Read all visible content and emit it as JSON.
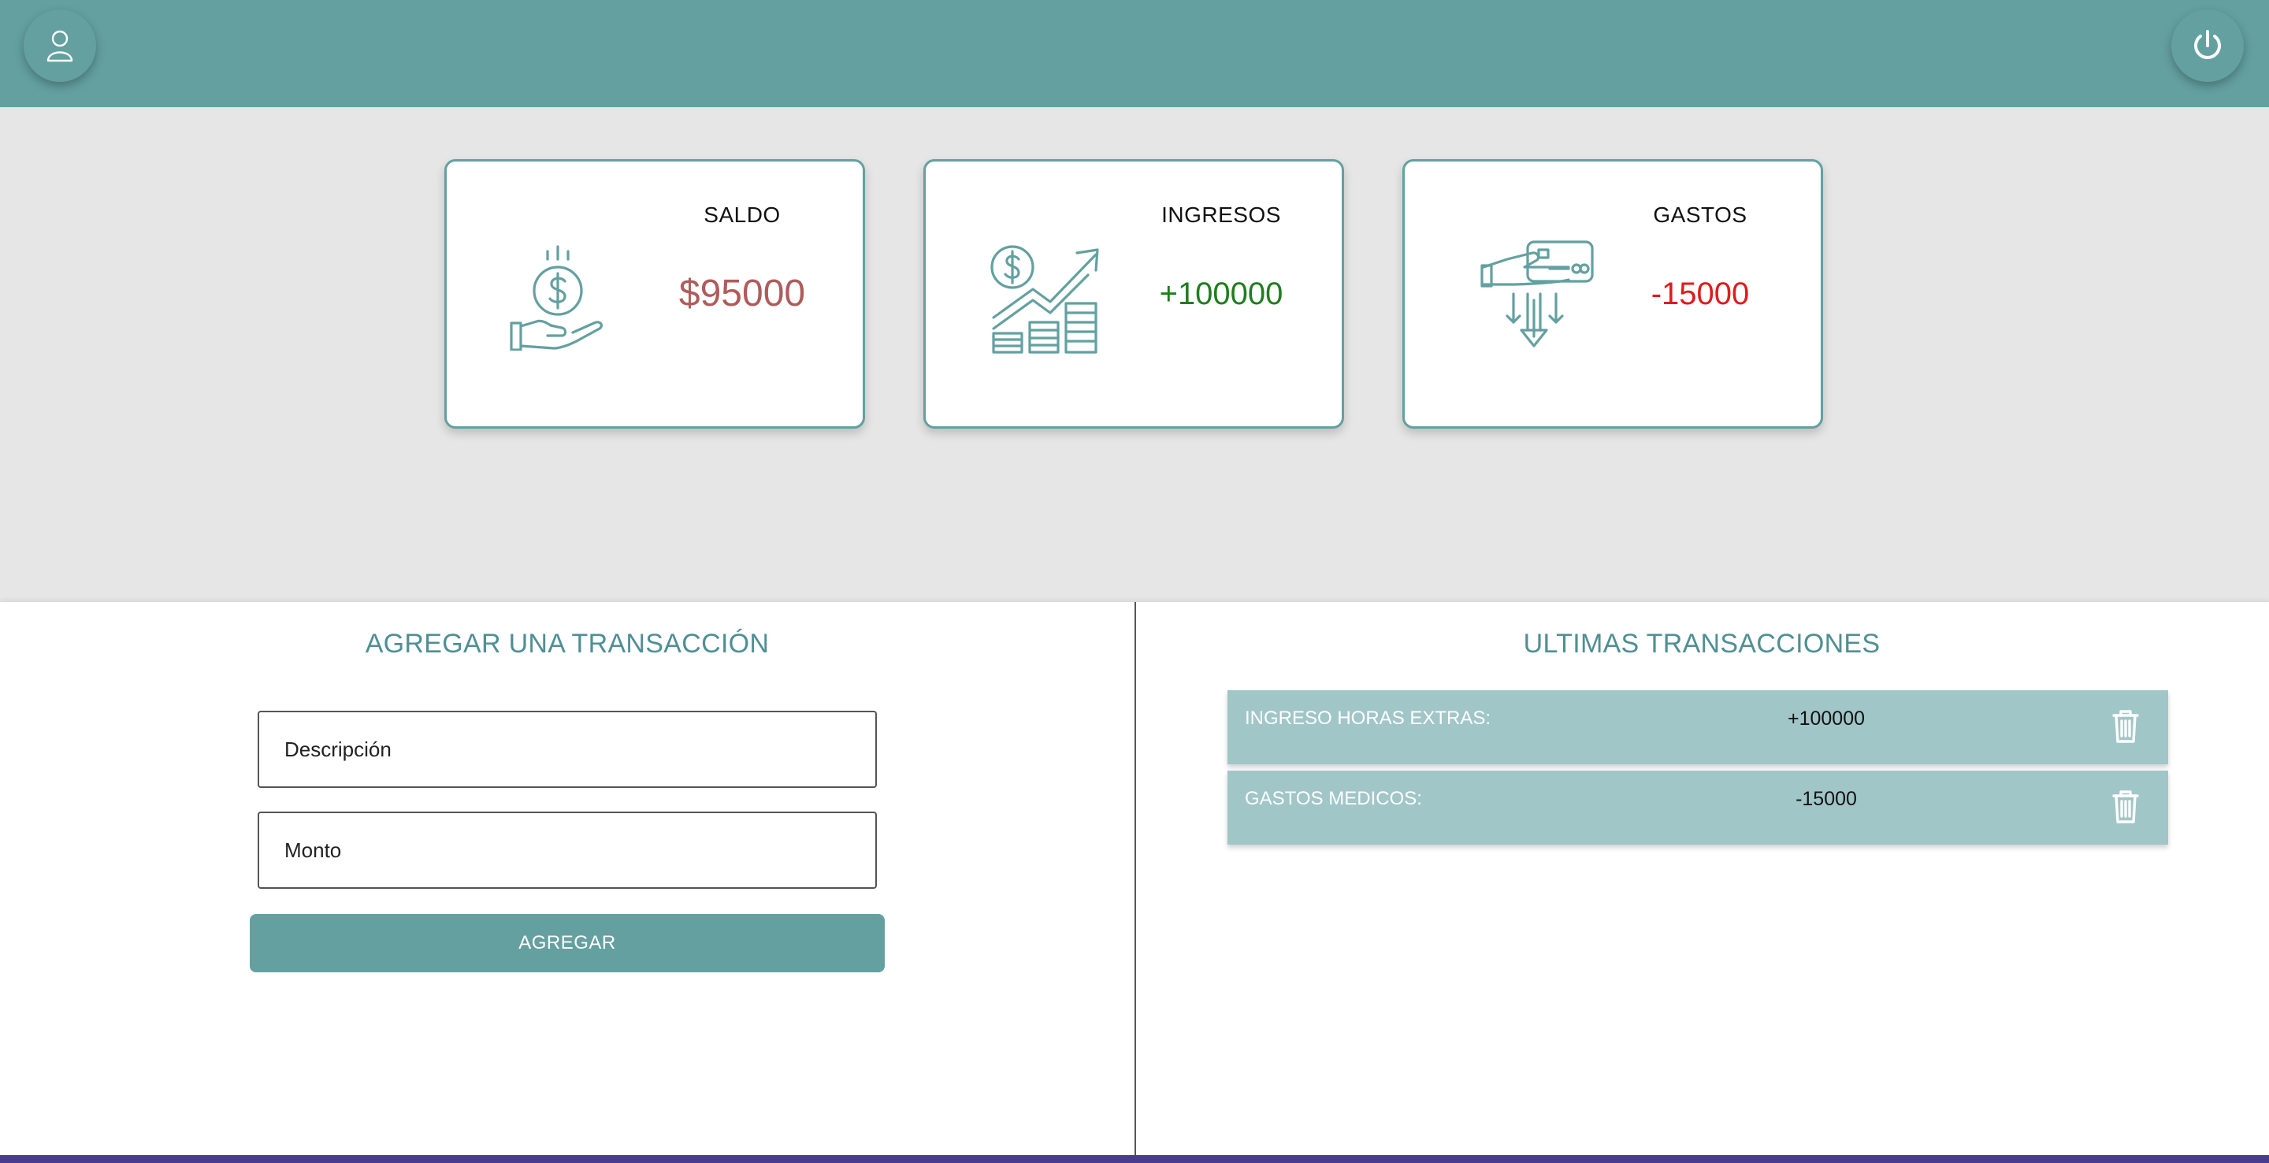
{
  "header": {
    "user_icon": "user-icon",
    "power_icon": "power-icon",
    "color": "#64a0a0"
  },
  "cards": {
    "saldo": {
      "title": "SALDO",
      "value": "$95000",
      "icon": "hand-coin-icon",
      "value_color": "#b05b5b"
    },
    "ingresos": {
      "title": "INGRESOS",
      "value": "+100000",
      "icon": "growth-chart-icon",
      "value_color": "#1e7e1e"
    },
    "gastos": {
      "title": "GASTOS",
      "value": "-15000",
      "icon": "card-payment-down-icon",
      "value_color": "#e01b1b"
    }
  },
  "form": {
    "title": "AGREGAR UNA TRANSACCIÓN",
    "description_placeholder": "Descripción",
    "amount_placeholder": "Monto",
    "submit_label": "AGREGAR"
  },
  "transactions": {
    "title": "ULTIMAS TRANSACCIONES",
    "items": [
      {
        "description": "INGRESO HORAS EXTRAS:",
        "amount": "+100000",
        "delete_icon": "trash-icon"
      },
      {
        "description": "GASTOS MEDICOS:",
        "amount": "-15000",
        "delete_icon": "trash-icon"
      }
    ]
  },
  "colors": {
    "accent": "#64a0a0",
    "row_bg": "#a1c6c8",
    "title_teal": "#4f8f94"
  }
}
